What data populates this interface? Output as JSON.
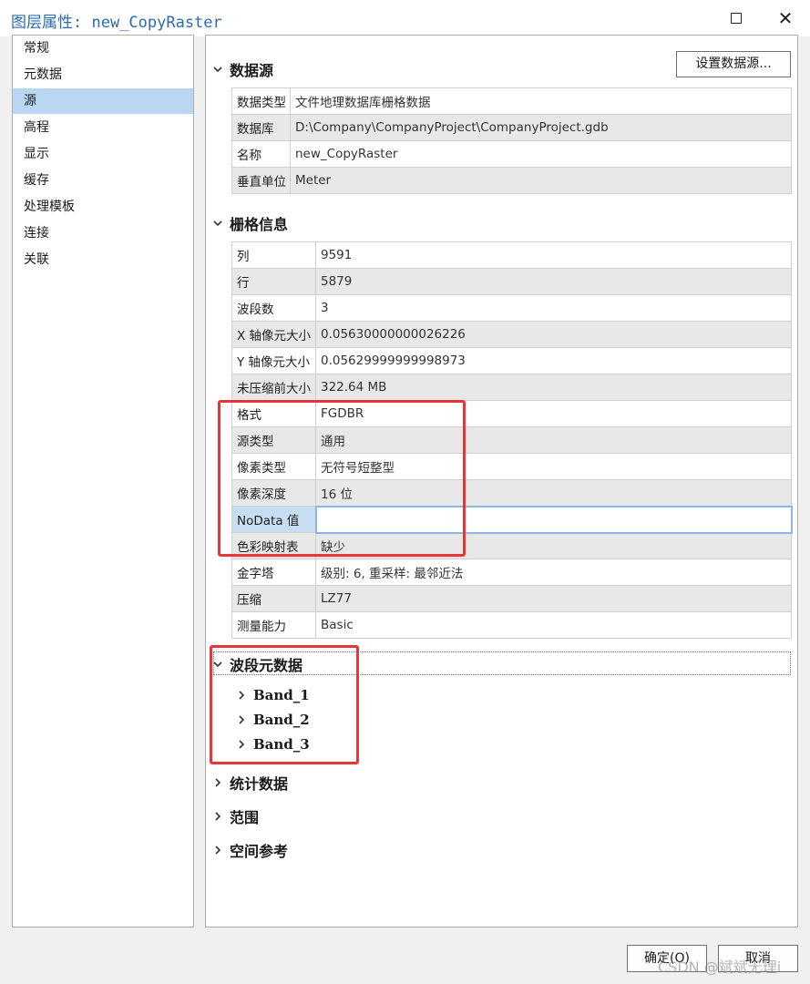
{
  "window": {
    "title": "图层属性: new_CopyRaster"
  },
  "nav": {
    "items": [
      "常规",
      "元数据",
      "源",
      "高程",
      "显示",
      "缓存",
      "处理模板",
      "连接",
      "关联"
    ],
    "selected_index": 2
  },
  "datasource": {
    "heading": "数据源",
    "set_button": "设置数据源...",
    "rows": [
      {
        "key": "数据类型",
        "value": "文件地理数据库栅格数据"
      },
      {
        "key": "数据库",
        "value": "D:\\Company\\CompanyProject\\CompanyProject.gdb"
      },
      {
        "key": "名称",
        "value": "new_CopyRaster"
      },
      {
        "key": "垂直单位",
        "value": "Meter"
      }
    ]
  },
  "raster_info": {
    "heading": "栅格信息",
    "rows": [
      {
        "key": "列",
        "value": "9591"
      },
      {
        "key": "行",
        "value": "5879"
      },
      {
        "key": "波段数",
        "value": "3"
      },
      {
        "key": "X 轴像元大小",
        "value": "0.05630000000026226"
      },
      {
        "key": "Y 轴像元大小",
        "value": "0.05629999999998973"
      },
      {
        "key": "未压缩前大小",
        "value": "322.64 MB"
      },
      {
        "key": "格式",
        "value": "FGDBR"
      },
      {
        "key": "源类型",
        "value": "通用"
      },
      {
        "key": "像素类型",
        "value": "无符号短整型"
      },
      {
        "key": "像素深度",
        "value": "16 位"
      },
      {
        "key": "NoData 值",
        "value": ""
      },
      {
        "key": "色彩映射表",
        "value": "缺少"
      },
      {
        "key": "金字塔",
        "value": "级别: 6, 重采样: 最邻近法"
      },
      {
        "key": "压缩",
        "value": "LZ77"
      },
      {
        "key": "测量能力",
        "value": "Basic"
      }
    ]
  },
  "band_metadata": {
    "heading": "波段元数据",
    "bands": [
      "Band_1",
      "Band_2",
      "Band_3"
    ]
  },
  "collapsed_sections": [
    "统计数据",
    "范围",
    "空间参考"
  ],
  "footer": {
    "ok_label": "确定(O)",
    "cancel_label": "取消"
  },
  "watermark": "CSDN @斌斌无理i",
  "colors": {
    "title_text": "#2b6cb0",
    "nav_selected": "#b9d7f1",
    "annotation_red": "#e8353a"
  }
}
